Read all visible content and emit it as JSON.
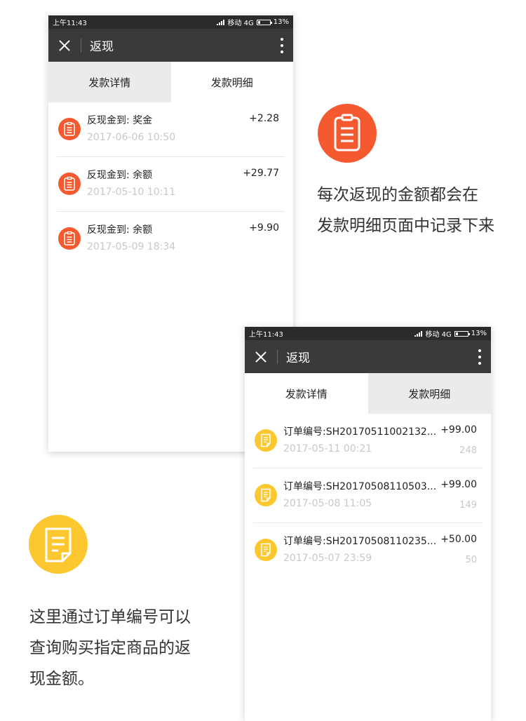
{
  "phone1": {
    "status": {
      "time": "上午11:43",
      "carrier": "移动 4G",
      "battery": "13%"
    },
    "title": "返现",
    "tabs": [
      {
        "label": "发款详情"
      },
      {
        "label": "发款明细"
      }
    ],
    "items": [
      {
        "title": "反现金到: 奖金",
        "time": "2017-06-06 10:50",
        "amount": "+2.28"
      },
      {
        "title": "反现金到: 余额",
        "time": "2017-05-10 10:11",
        "amount": "+29.77"
      },
      {
        "title": "反现金到: 余额",
        "time": "2017-05-09 18:34",
        "amount": "+9.90"
      }
    ]
  },
  "phone2": {
    "status": {
      "time": "上午11:43",
      "carrier": "移动 4G",
      "battery": "13%"
    },
    "title": "返现",
    "tabs": [
      {
        "label": "发款详情"
      },
      {
        "label": "发款明细"
      }
    ],
    "items": [
      {
        "title": "订单编号:SH20170511002132...",
        "time": "2017-05-11 00:21",
        "amount": "+99.00",
        "count": "248"
      },
      {
        "title": "订单编号:SH20170508110503...",
        "time": "2017-05-08 11:05",
        "amount": "+99.00",
        "count": "149"
      },
      {
        "title": "订单编号:SH20170508110235...",
        "time": "2017-05-07 23:59",
        "amount": "+50.00",
        "count": "50"
      }
    ]
  },
  "caption_right": {
    "line1": "每次返现的金额都会在",
    "line2": "发款明细页面中记录下来"
  },
  "caption_left": {
    "line1": "这里通过订单编号可以",
    "line2": "查询购买指定商品的返",
    "line3": "现金额。"
  },
  "colors": {
    "orange": "#f4592f",
    "yellow": "#fcc72f",
    "titlebar": "#3a3a3a",
    "statusbar": "#2b2b2b"
  },
  "icons": {
    "clipboard": "clipboard-icon",
    "document": "document-icon",
    "close": "close-icon",
    "more": "more-vertical-icon"
  }
}
